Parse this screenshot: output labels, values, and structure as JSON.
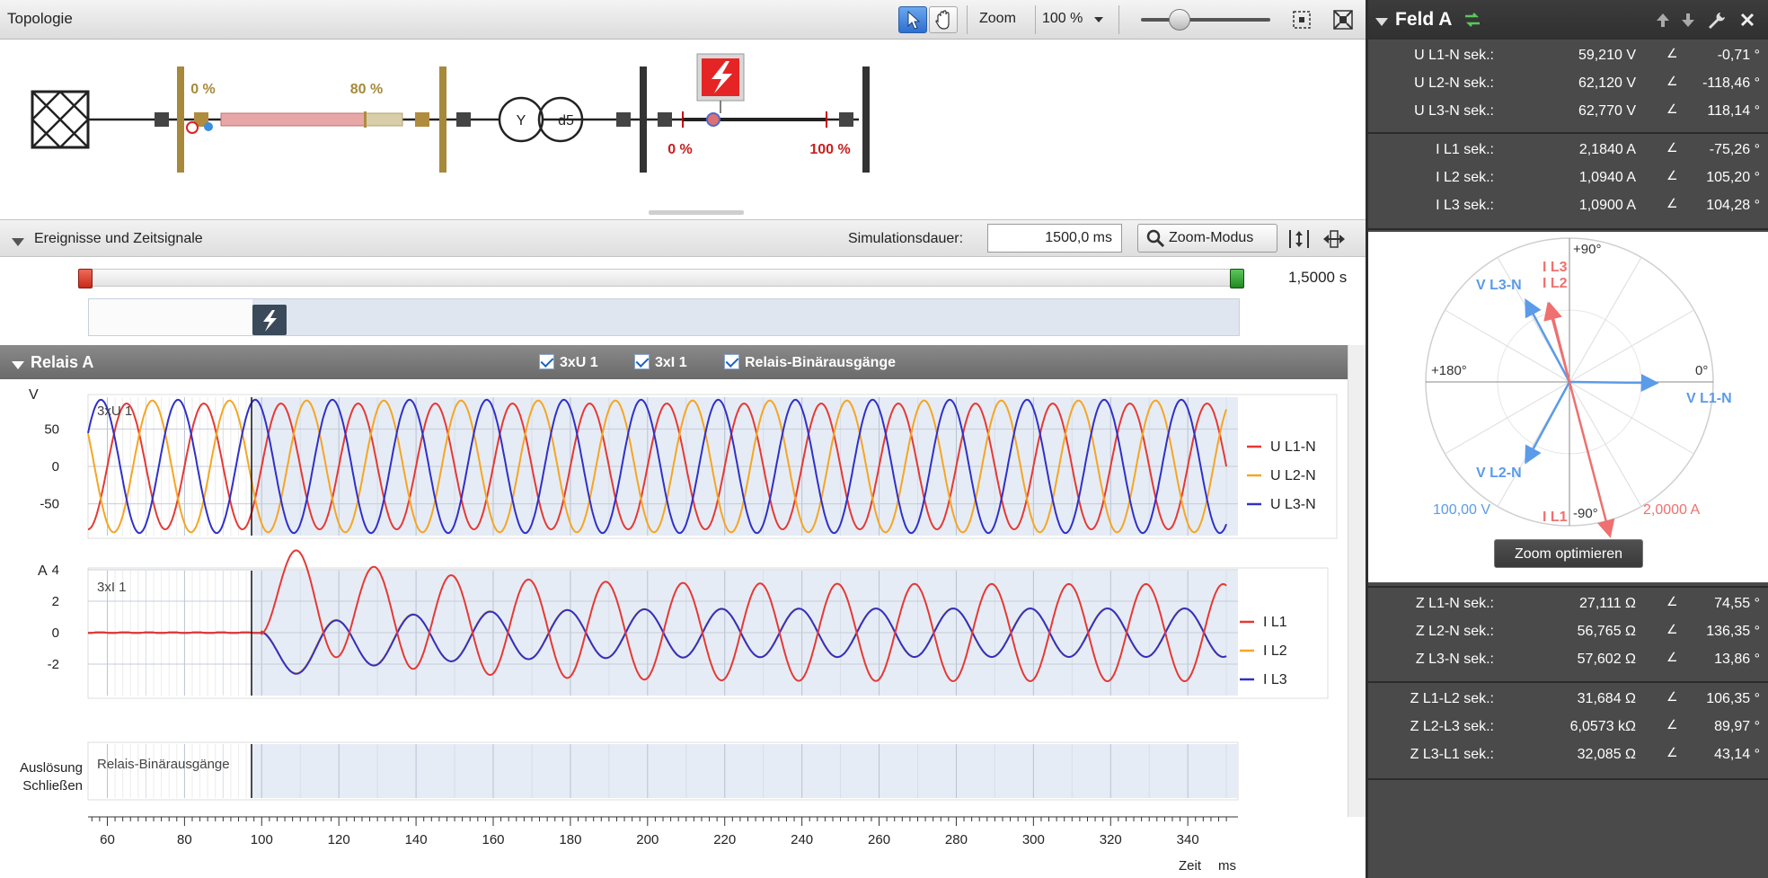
{
  "topology": {
    "title": "Topologie",
    "zoom_label": "Zoom",
    "zoom_value": "100 %",
    "zoom_slider_fraction": 0.3,
    "line1": {
      "start": "0 %",
      "end": "80 %"
    },
    "line2": {
      "start": "0 %",
      "end": "100 %"
    },
    "transformer": {
      "primary": "Y",
      "secondary": "d5"
    }
  },
  "events": {
    "title": "Ereignisse und Zeitsignale",
    "sim_label": "Simulationsdauer:",
    "sim_value": "1500,0 ms",
    "zoom_mode": "Zoom-Modus",
    "time_end": "1,5000 s"
  },
  "relais": {
    "title": "Relais A",
    "checks": [
      "3xU 1",
      "3xI 1",
      "Relais-Binärausgänge"
    ]
  },
  "charts": {
    "voltage": {
      "unit": "V",
      "title": "3xU 1",
      "yticks": [
        "50",
        "0",
        "-50"
      ],
      "legend": [
        "U L1-N",
        "U L2-N",
        "U L3-N"
      ]
    },
    "current": {
      "unit": "A",
      "title": "3xI 1",
      "yticks": [
        "4",
        "2",
        "0",
        "-2"
      ],
      "legend": [
        "I L1",
        "I L2",
        "I L3"
      ]
    },
    "binary": {
      "title": "Relais-Binärausgänge",
      "labels": [
        "Auslösung",
        "Schließen"
      ]
    },
    "xaxis": {
      "ticks": [
        "60",
        "80",
        "100",
        "120",
        "140",
        "160",
        "180",
        "200",
        "220",
        "240",
        "260",
        "280",
        "300",
        "320",
        "340"
      ],
      "label": "Zeit",
      "unit": "ms"
    },
    "colors": {
      "L1": "#e53935",
      "L2": "#f5a623",
      "L3": "#3030c8"
    }
  },
  "panel": {
    "title": "Feld A",
    "voltages": [
      {
        "label": "U L1-N sek.:",
        "value": "59,210 V",
        "angle": "-0,71 °"
      },
      {
        "label": "U L2-N sek.:",
        "value": "62,120 V",
        "angle": "-118,46 °"
      },
      {
        "label": "U L3-N sek.:",
        "value": "62,770 V",
        "angle": "118,14 °"
      }
    ],
    "currents": [
      {
        "label": "I L1 sek.:",
        "value": "2,1840 A",
        "angle": "-75,26 °"
      },
      {
        "label": "I L2 sek.:",
        "value": "1,0940 A",
        "angle": "105,20 °"
      },
      {
        "label": "I L3 sek.:",
        "value": "1,0900 A",
        "angle": "104,28 °"
      }
    ],
    "polar": {
      "plus90": "+90°",
      "minus90": "-90°",
      "plus180": "+180°",
      "zero": "0°",
      "vector_labels": {
        "VL1N": "V L1-N",
        "VL2N": "V L2-N",
        "VL3N": "V L3-N",
        "IL1": "I L1",
        "IL2": "I L2",
        "IL3": "I L3"
      },
      "voltage_scale": "100,00 V",
      "current_scale": "2,0000 A",
      "zoom_button": "Zoom optimieren"
    },
    "impedances": [
      {
        "label": "Z L1-N sek.:",
        "value": "27,111 Ω",
        "angle": "74,55 °"
      },
      {
        "label": "Z L2-N sek.:",
        "value": "56,765 Ω",
        "angle": "136,35 °"
      },
      {
        "label": "Z L3-N sek.:",
        "value": "57,602 Ω",
        "angle": "13,86 °"
      }
    ],
    "loop_impedances": [
      {
        "label": "Z L1-L2 sek.:",
        "value": "31,684 Ω",
        "angle": "106,35 °"
      },
      {
        "label": "Z L2-L3 sek.:",
        "value": "6,0573 kΩ",
        "angle": "89,97 °"
      },
      {
        "label": "Z L3-L1 sek.:",
        "value": "32,085 Ω",
        "angle": "43,14 °"
      }
    ]
  }
}
